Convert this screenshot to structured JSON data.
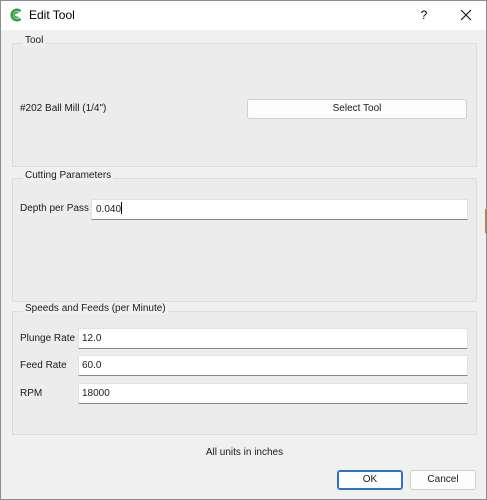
{
  "window": {
    "title": "Edit Tool",
    "help_label": "?",
    "app_icon": "app-logo-icon",
    "close_icon": "close-icon"
  },
  "tool_group": {
    "title": "Tool",
    "tool_name": "#202 Ball Mill (1/4\")",
    "select_button": "Select Tool"
  },
  "cutting_group": {
    "title": "Cutting Parameters",
    "depth_label": "Depth per Pass",
    "depth_value": "0.040"
  },
  "speeds_group": {
    "title": "Speeds and Feeds (per Minute)",
    "plunge_label": "Plunge Rate",
    "plunge_value": "12.0",
    "feed_label": "Feed Rate",
    "feed_value": "60.0",
    "rpm_label": "RPM",
    "rpm_value": "18000"
  },
  "footer": {
    "note": "All units in inches",
    "ok_label": "OK",
    "cancel_label": "Cancel"
  },
  "colors": {
    "accent": "#2b72c8",
    "app_icon_green": "#2e9e44"
  }
}
